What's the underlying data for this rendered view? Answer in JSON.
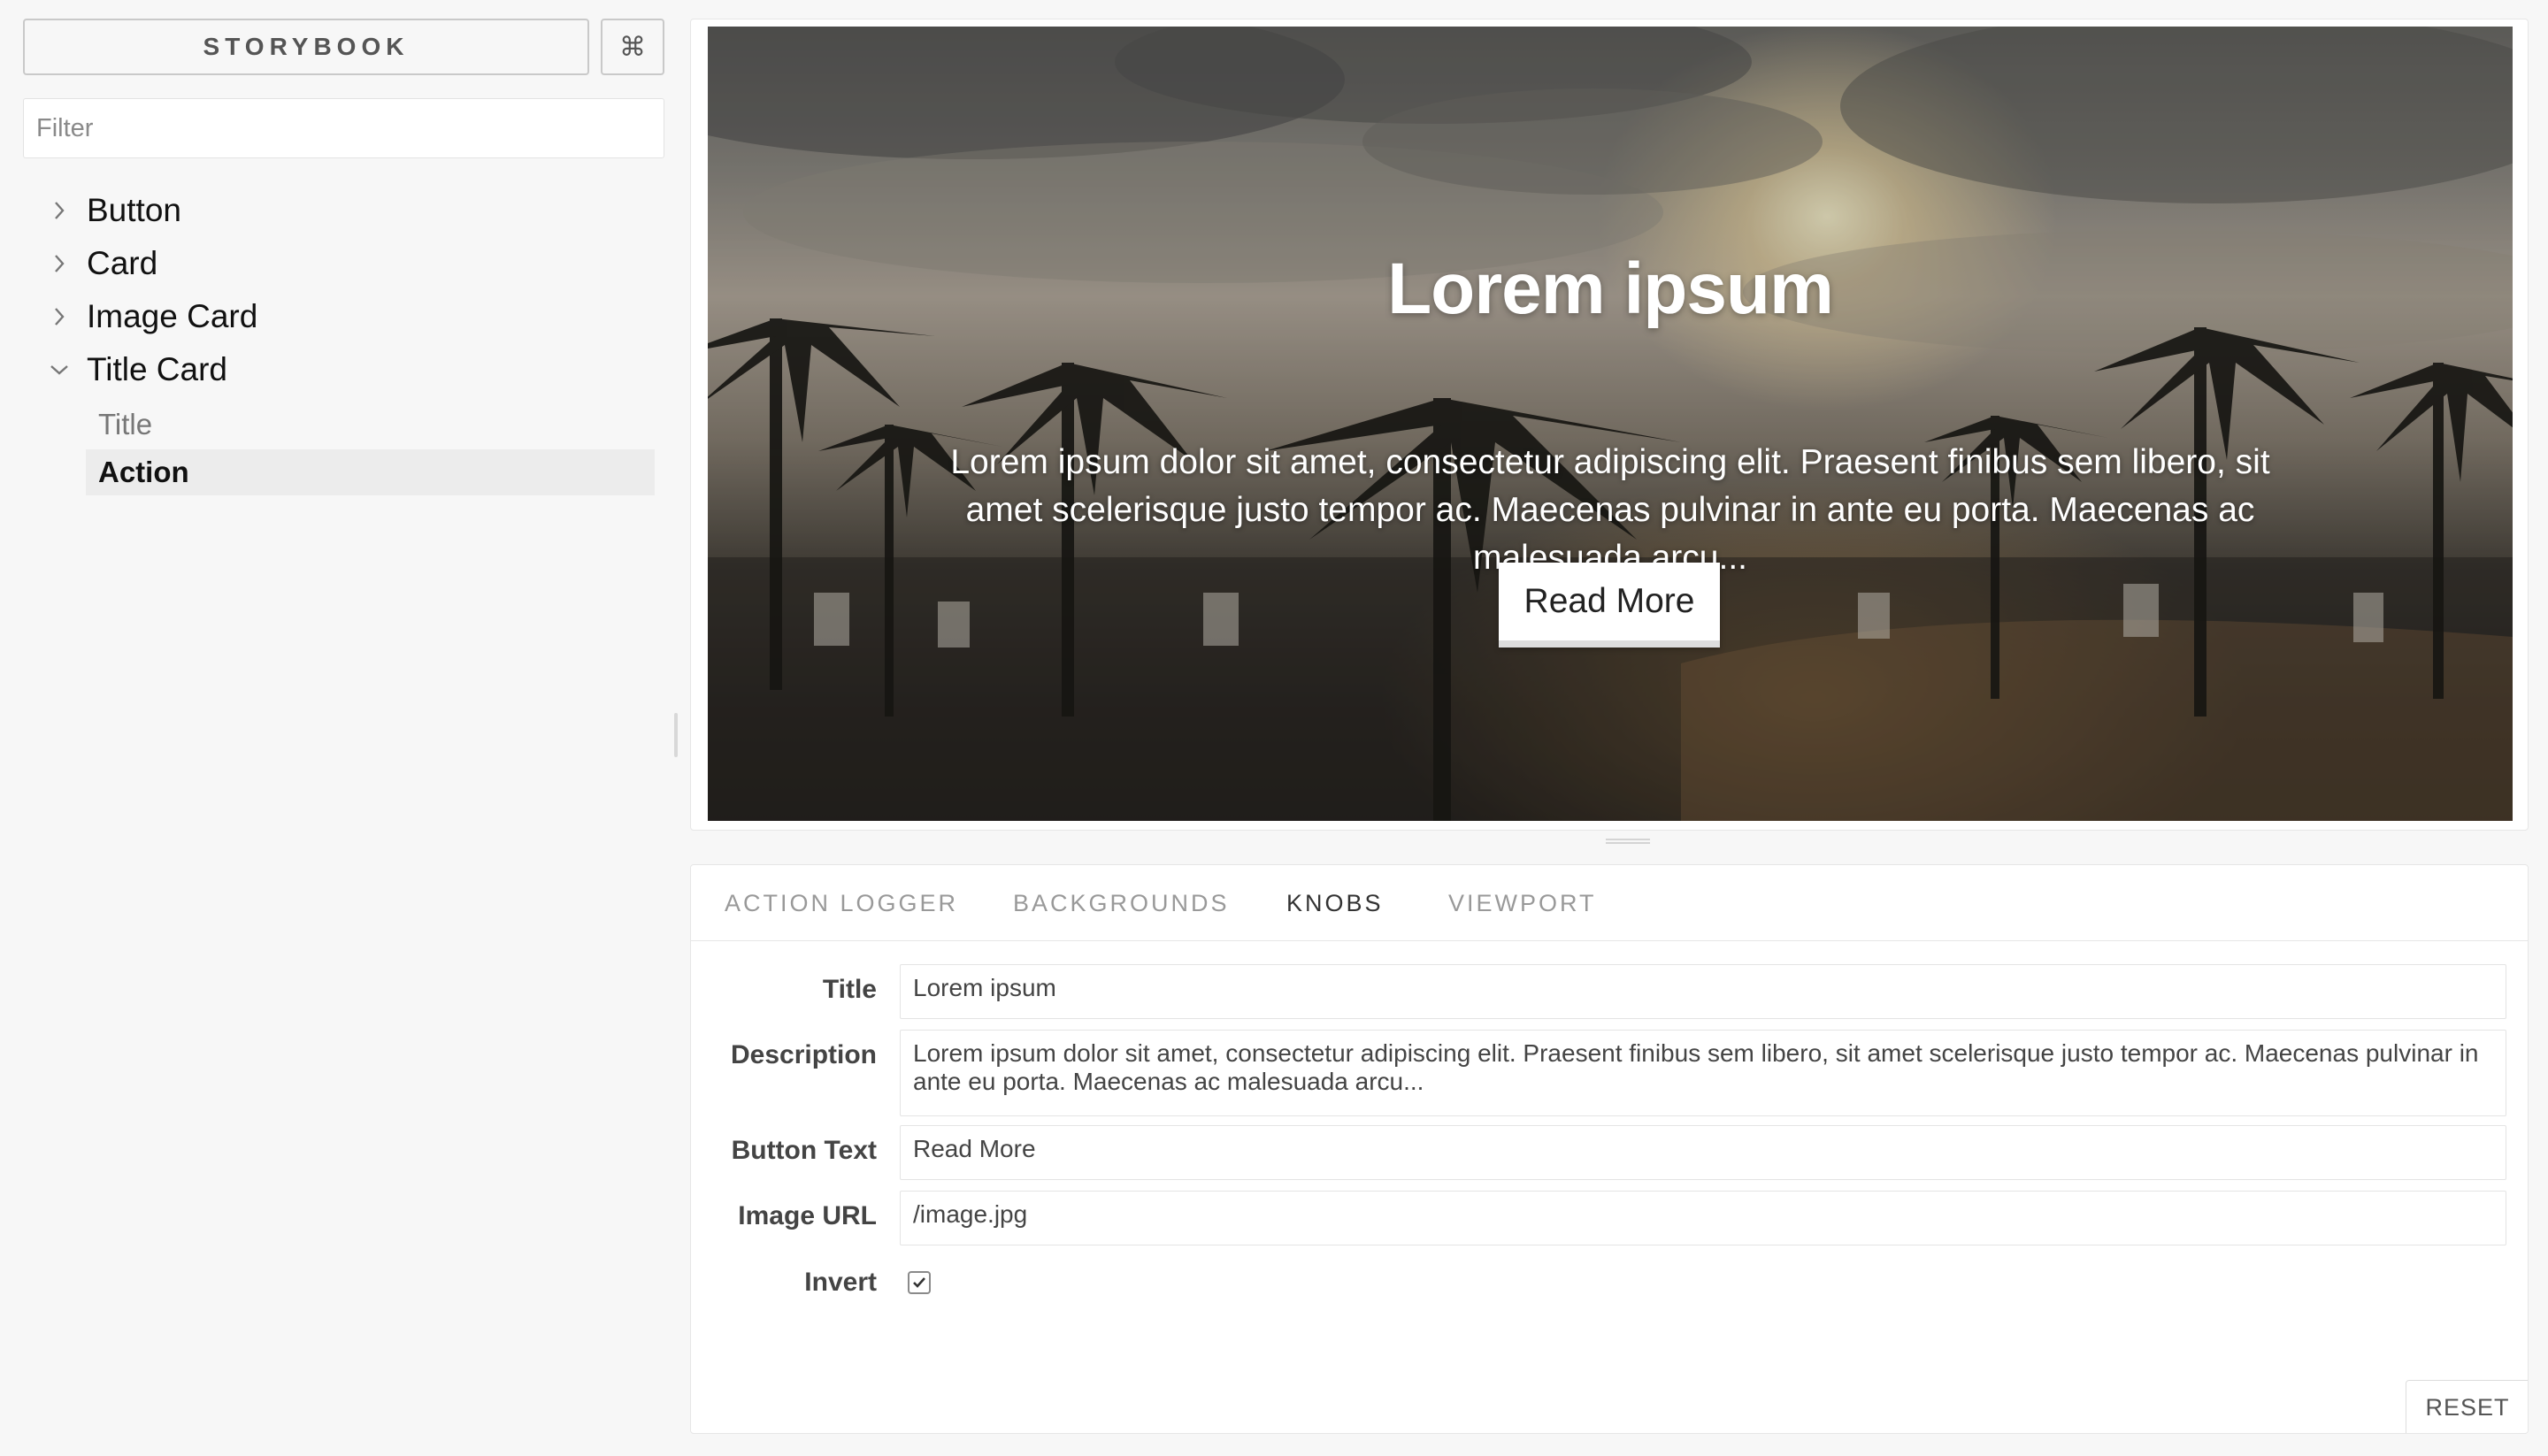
{
  "sidebar": {
    "brand": "STORYBOOK",
    "shortcut_icon": "command-icon",
    "shortcut_glyph": "⌘",
    "filter_placeholder": "Filter",
    "tree": [
      {
        "label": "Button",
        "expanded": false
      },
      {
        "label": "Card",
        "expanded": false
      },
      {
        "label": "Image Card",
        "expanded": false
      },
      {
        "label": "Title Card",
        "expanded": true,
        "children": [
          {
            "label": "Title",
            "selected": false
          },
          {
            "label": "Action",
            "selected": true
          }
        ]
      }
    ]
  },
  "preview": {
    "title": "Lorem ipsum",
    "description": "Lorem ipsum dolor sit amet, consectetur adipiscing elit. Praesent finibus sem libero, sit amet scelerisque justo tempor ac. Maecenas pulvinar in ante eu porta. Maecenas ac malesuada arcu...",
    "button": "Read More"
  },
  "panel": {
    "tabs": [
      {
        "label": "ACTION LOGGER",
        "active": false
      },
      {
        "label": "BACKGROUNDS",
        "active": false
      },
      {
        "label": "KNOBS",
        "active": true
      },
      {
        "label": "VIEWPORT",
        "active": false
      }
    ],
    "knobs": {
      "title": {
        "label": "Title",
        "value": "Lorem ipsum"
      },
      "description": {
        "label": "Description",
        "value": "Lorem ipsum dolor sit amet, consectetur adipiscing elit. Praesent finibus sem libero, sit amet scelerisque justo tempor ac. Maecenas pulvinar in ante eu porta. Maecenas ac malesuada arcu..."
      },
      "button_text": {
        "label": "Button Text",
        "value": "Read More"
      },
      "image_url": {
        "label": "Image URL",
        "value": "/image.jpg"
      },
      "invert": {
        "label": "Invert",
        "checked": true
      }
    },
    "reset": "RESET"
  },
  "colors": {
    "background": "#f7f7f7",
    "panel": "#ffffff",
    "border": "#e6e6e6",
    "active_text": "#333333",
    "muted_text": "#999999"
  }
}
